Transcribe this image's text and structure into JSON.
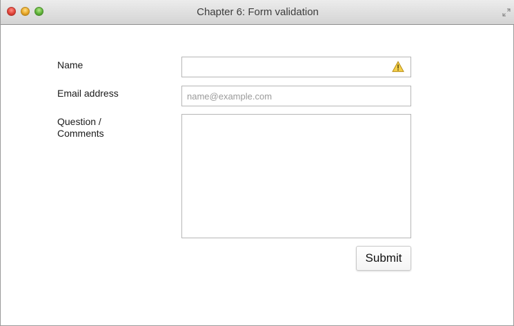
{
  "window": {
    "title": "Chapter 6: Form validation"
  },
  "form": {
    "name_label": "Name",
    "name_value": "",
    "email_label": "Email address",
    "email_placeholder": "name@example.com",
    "email_value": "",
    "comments_label": "Question / Comments",
    "comments_value": "",
    "submit_label": "Submit"
  },
  "icons": {
    "warning": "warning-icon",
    "fullscreen": "fullscreen-icon"
  },
  "colors": {
    "close": "#e1443a",
    "minimize": "#e8a626",
    "maximize": "#5fb33a",
    "warning": "#f2c230"
  }
}
